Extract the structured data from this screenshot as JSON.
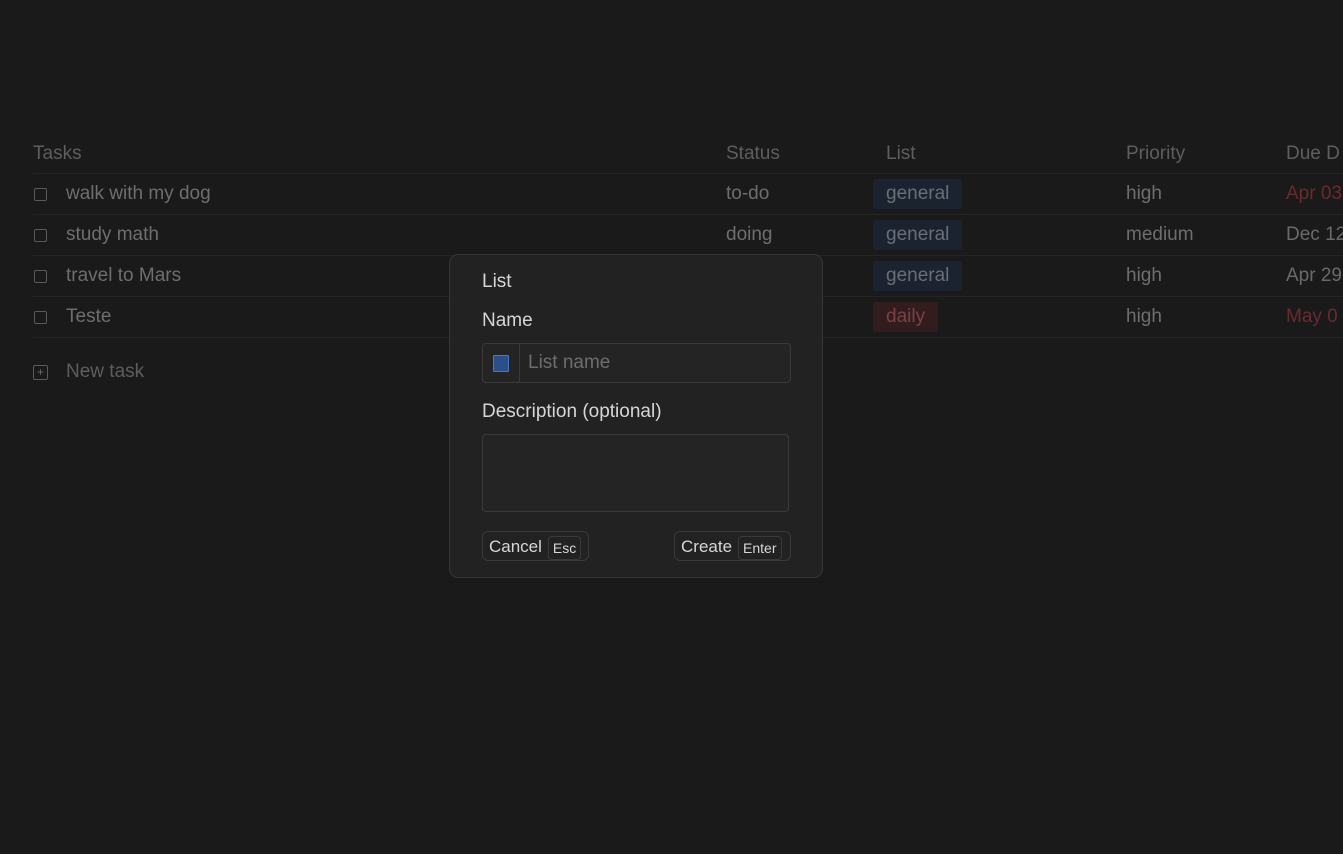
{
  "table": {
    "headers": {
      "tasks": "Tasks",
      "status": "Status",
      "list": "List",
      "priority": "Priority",
      "due": "Due D"
    },
    "rows": [
      {
        "task": "walk with my dog",
        "status": "to-do",
        "list": "general",
        "priority": "high",
        "due": "Apr 03"
      },
      {
        "task": "study math",
        "status": "doing",
        "list": "general",
        "priority": "medium",
        "due": "Dec 12"
      },
      {
        "task": "travel to Mars",
        "status": "",
        "list": "general",
        "priority": "high",
        "due": "Apr 29"
      },
      {
        "task": "Teste",
        "status": "",
        "list": "daily",
        "priority": "high",
        "due": "May 0"
      }
    ],
    "new_task_label": "New task"
  },
  "modal": {
    "title": "List",
    "name_label": "Name",
    "name_placeholder": "List name",
    "name_value": "",
    "swatch_color": "#2a4f8a",
    "description_label": "Description (optional)",
    "description_value": "",
    "cancel_label": "Cancel",
    "cancel_key": "Esc",
    "create_label": "Create",
    "create_key": "Enter"
  },
  "colors": {
    "background": "#1a1a1a",
    "modal_background": "#222222",
    "overdue_red": "#6a2a30",
    "tag_general_bg": "#1c2330",
    "tag_daily_bg": "#331c1e"
  }
}
